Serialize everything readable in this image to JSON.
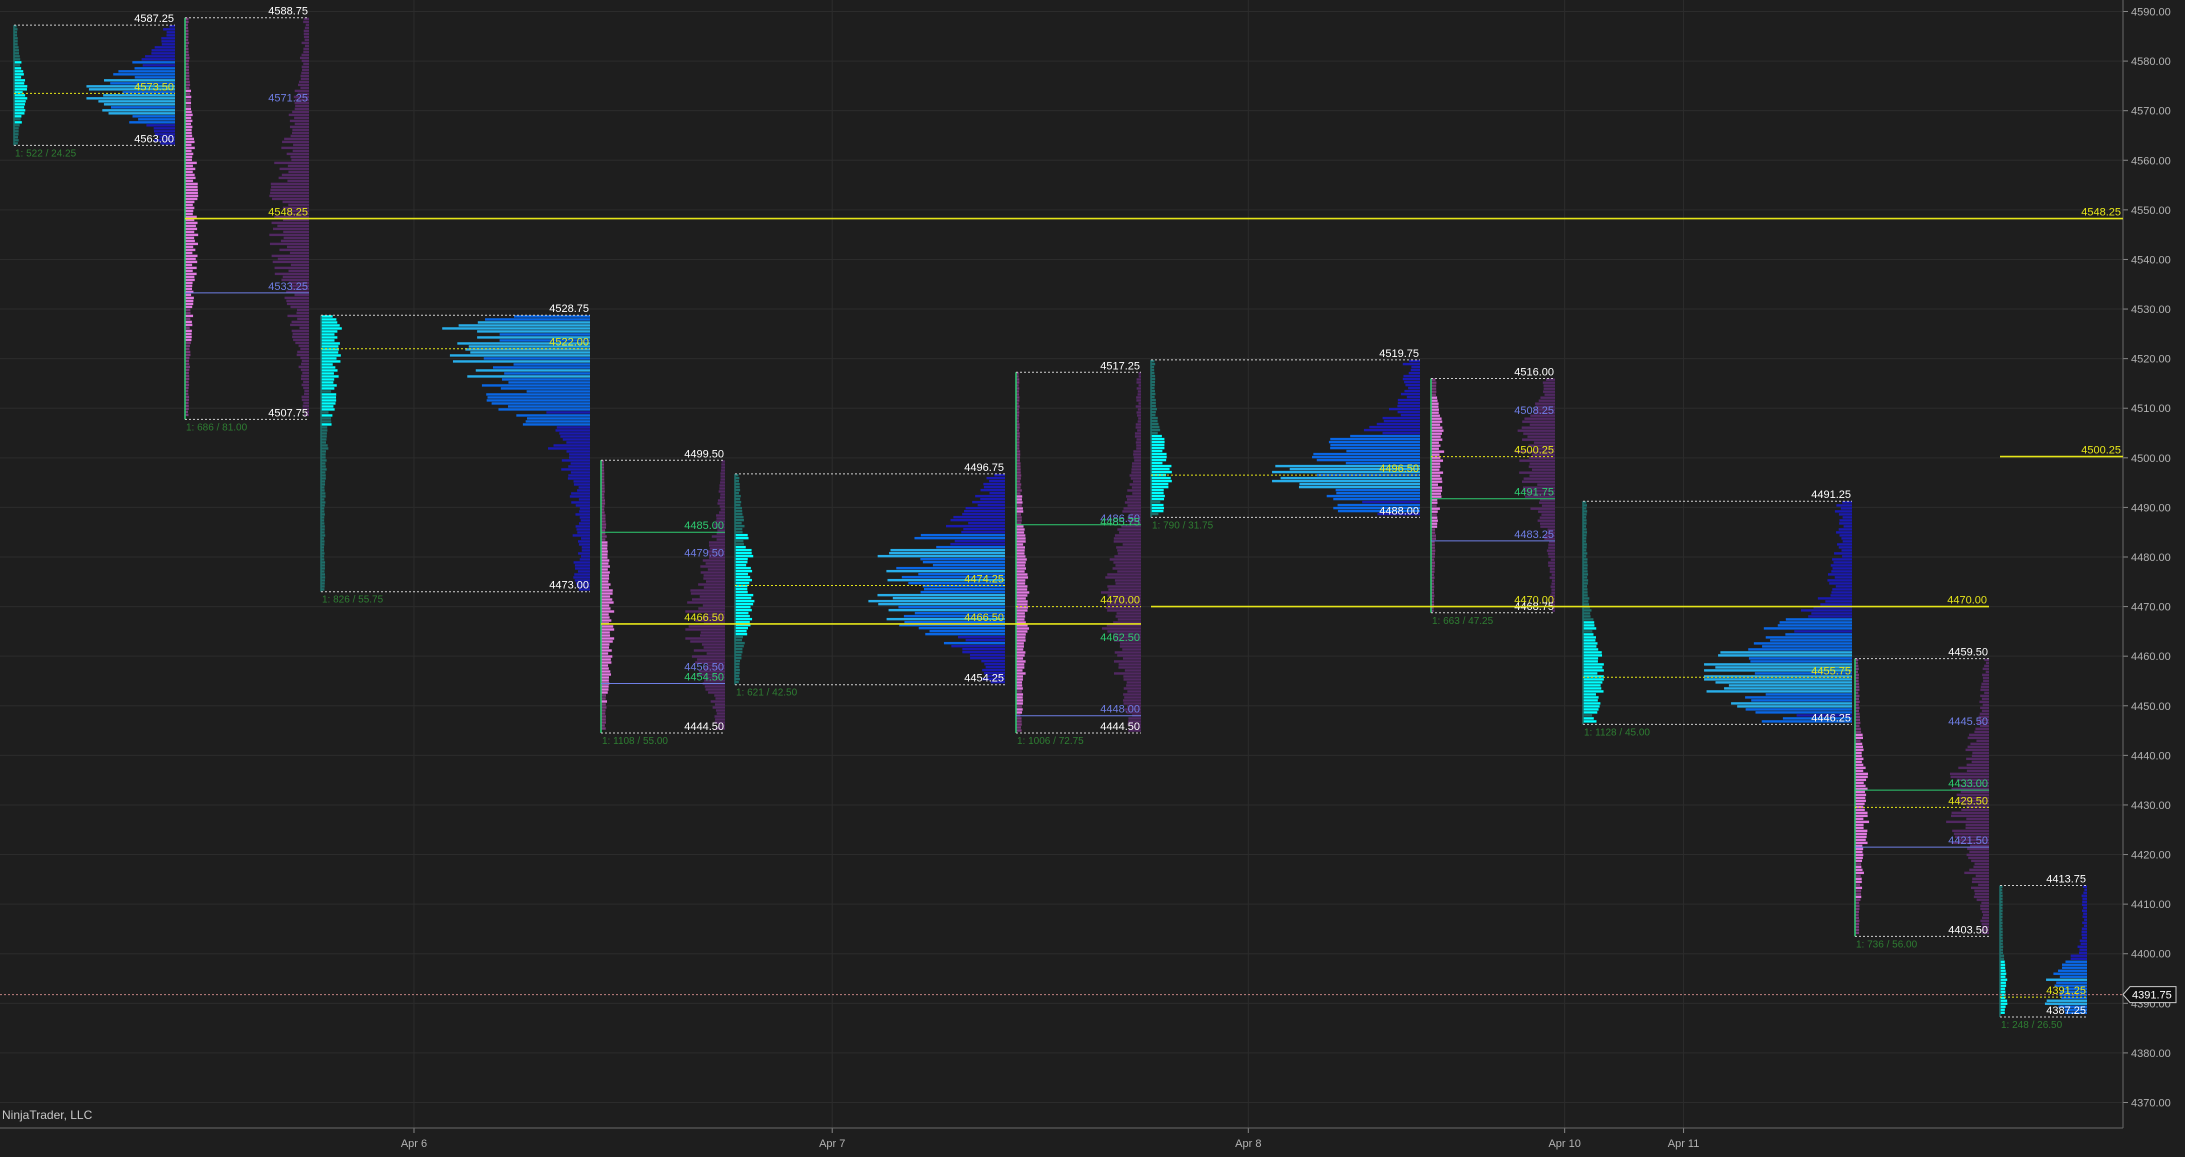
{
  "watermark": "NinjaTrader, LLC",
  "colors": {
    "background": "#1e1e1e",
    "grid": "#2c2c2c",
    "axis_text": "#b4b4b4",
    "box": "#d0d0d0",
    "poc": "#e6e619",
    "vah": "#2ecc71",
    "val": "#6f7fe6",
    "label_white": "#ffffff",
    "stats": "#2e7d32",
    "cyan": "#00ffff",
    "teal": "#1e6e6a",
    "pink": "#e07ae0",
    "purple": "#5a2a6e",
    "blue": "#0a6bf0",
    "navy": "#1a1ab8",
    "current_line": "#c08080"
  },
  "chart_data": {
    "type": "volume_profile",
    "grid": true,
    "ylim": [
      4366,
      4592
    ],
    "y_ticks": [
      "4590.00",
      "4580.00",
      "4570.00",
      "4560.00",
      "4550.00",
      "4540.00",
      "4530.00",
      "4520.00",
      "4510.00",
      "4500.00",
      "4490.00",
      "4480.00",
      "4470.00",
      "4460.00",
      "4450.00",
      "4440.00",
      "4430.00",
      "4420.00",
      "4410.00",
      "4400.00",
      "4390.00",
      "4380.00",
      "4370.00"
    ],
    "x_ticks": [
      {
        "label": "Apr 6",
        "pos": 0.195
      },
      {
        "label": "Apr 7",
        "pos": 0.392
      },
      {
        "label": "Apr 8",
        "pos": 0.588
      },
      {
        "label": "Apr 10",
        "pos": 0.737
      },
      {
        "label": "Apr 11",
        "pos": 0.793
      }
    ],
    "current_price": {
      "value": 4391.75,
      "label": "4391.75"
    },
    "extended_levels": [
      {
        "value": 4548.25,
        "label": "4548.25",
        "from_profile": 1
      },
      {
        "value": 4500.25,
        "label": "4500.25",
        "from_profile": 10
      },
      {
        "value": 4470.0,
        "label": "4470.00",
        "from_profile": 6,
        "to_profile": 9
      },
      {
        "value": 4466.5,
        "label": "",
        "from_profile": 3,
        "to_profile": 5
      }
    ],
    "profiles": [
      {
        "kind": "A",
        "high": 4587.25,
        "low": 4563.0,
        "poc": 4573.5,
        "vah": null,
        "val": null,
        "stats": "1: 522 / 24.25",
        "labels": [
          {
            "v": 4587.25,
            "t": "4587.25",
            "c": "w"
          },
          {
            "v": 4573.5,
            "t": "4573.50",
            "c": "p"
          },
          {
            "v": 4563.0,
            "t": "4563.00",
            "c": "w"
          }
        ]
      },
      {
        "kind": "B",
        "high": 4588.75,
        "low": 4507.75,
        "poc": 4548.25,
        "vah": null,
        "val": 4533.25,
        "stats": "1: 686 / 81.00",
        "labels": [
          {
            "v": 4588.75,
            "t": "4588.75",
            "c": "w"
          },
          {
            "v": 4571.25,
            "t": "4571.25",
            "c": "l"
          },
          {
            "v": 4548.25,
            "t": "4548.25",
            "c": "p"
          },
          {
            "v": 4533.25,
            "t": "4533.25",
            "c": "l"
          },
          {
            "v": 4507.75,
            "t": "4507.75",
            "c": "w"
          }
        ]
      },
      {
        "kind": "A",
        "high": 4528.75,
        "low": 4473.0,
        "poc": 4522.0,
        "vah": null,
        "val": null,
        "stats": "1: 826 / 55.75",
        "labels": [
          {
            "v": 4528.75,
            "t": "4528.75",
            "c": "w"
          },
          {
            "v": 4522.0,
            "t": "4522.00",
            "c": "p"
          },
          {
            "v": 4473.0,
            "t": "4473.00",
            "c": "w"
          }
        ]
      },
      {
        "kind": "B",
        "high": 4499.5,
        "low": 4444.5,
        "poc": 4466.5,
        "vah": 4485.0,
        "val": 4454.5,
        "stats": "1: 1108 / 55.00",
        "labels": [
          {
            "v": 4499.5,
            "t": "4499.50",
            "c": "w"
          },
          {
            "v": 4485.0,
            "t": "4485.00",
            "c": "g"
          },
          {
            "v": 4479.5,
            "t": "4479.50",
            "c": "l"
          },
          {
            "v": 4466.5,
            "t": "4466.50",
            "c": "p"
          },
          {
            "v": 4456.5,
            "t": "4456.50",
            "c": "l"
          },
          {
            "v": 4454.5,
            "t": "4454.50",
            "c": "g"
          },
          {
            "v": 4444.5,
            "t": "4444.50",
            "c": "w"
          }
        ]
      },
      {
        "kind": "A",
        "high": 4496.75,
        "low": 4454.25,
        "poc": 4474.25,
        "vah": null,
        "val": null,
        "stats": "1: 621 / 42.50",
        "labels": [
          {
            "v": 4496.75,
            "t": "4496.75",
            "c": "w"
          },
          {
            "v": 4474.25,
            "t": "4474.25",
            "c": "p"
          },
          {
            "v": 4466.5,
            "t": "4466.50",
            "c": "p"
          },
          {
            "v": 4454.25,
            "t": "4454.25",
            "c": "w"
          }
        ]
      },
      {
        "kind": "B",
        "high": 4517.25,
        "low": 4444.5,
        "poc": 4470.0,
        "vah": 4486.5,
        "val": 4448.0,
        "stats": "1: 1006 / 72.75",
        "labels": [
          {
            "v": 4517.25,
            "t": "4517.25",
            "c": "w"
          },
          {
            "v": 4486.5,
            "t": "4486.50",
            "c": "l"
          },
          {
            "v": 4485.75,
            "t": "4485.75",
            "c": "g"
          },
          {
            "v": 4470.0,
            "t": "4470.00",
            "c": "p"
          },
          {
            "v": 4462.5,
            "t": "4462.50",
            "c": "g"
          },
          {
            "v": 4448.0,
            "t": "4448.00",
            "c": "l"
          },
          {
            "v": 4444.5,
            "t": "4444.50",
            "c": "w"
          }
        ]
      },
      {
        "kind": "A",
        "high": 4519.75,
        "low": 4488.0,
        "poc": 4496.5,
        "vah": null,
        "val": null,
        "stats": "1: 790 / 31.75",
        "labels": [
          {
            "v": 4519.75,
            "t": "4519.75",
            "c": "w"
          },
          {
            "v": 4496.5,
            "t": "4496.50",
            "c": "p"
          },
          {
            "v": 4488.0,
            "t": "4488.00",
            "c": "w"
          }
        ]
      },
      {
        "kind": "B",
        "high": 4516.0,
        "low": 4468.75,
        "poc": 4500.25,
        "vah": 4491.75,
        "val": 4483.25,
        "stats": "1: 663 / 47.25",
        "labels": [
          {
            "v": 4516.0,
            "t": "4516.00",
            "c": "w"
          },
          {
            "v": 4508.25,
            "t": "4508.25",
            "c": "l"
          },
          {
            "v": 4500.25,
            "t": "4500.25",
            "c": "p"
          },
          {
            "v": 4491.75,
            "t": "4491.75",
            "c": "g"
          },
          {
            "v": 4483.25,
            "t": "4483.25",
            "c": "l"
          },
          {
            "v": 4470.0,
            "t": "4470.00",
            "c": "p"
          },
          {
            "v": 4468.75,
            "t": "4468.75",
            "c": "w"
          }
        ]
      },
      {
        "kind": "A",
        "high": 4491.25,
        "low": 4446.25,
        "poc": 4455.75,
        "vah": null,
        "val": null,
        "stats": "1: 1128 / 45.00",
        "labels": [
          {
            "v": 4491.25,
            "t": "4491.25",
            "c": "w"
          },
          {
            "v": 4455.75,
            "t": "4455.75",
            "c": "p"
          },
          {
            "v": 4446.25,
            "t": "4446.25",
            "c": "w"
          }
        ]
      },
      {
        "kind": "B",
        "high": 4459.5,
        "low": 4403.5,
        "poc": 4429.5,
        "vah": 4433.0,
        "val": 4421.5,
        "stats": "1: 736 / 56.00",
        "labels": [
          {
            "v": 4459.5,
            "t": "4459.50",
            "c": "w"
          },
          {
            "v": 4445.5,
            "t": "4445.50",
            "c": "l"
          },
          {
            "v": 4433.0,
            "t": "4433.00",
            "c": "g"
          },
          {
            "v": 4429.5,
            "t": "4429.50",
            "c": "p"
          },
          {
            "v": 4421.5,
            "t": "4421.50",
            "c": "l"
          },
          {
            "v": 4403.5,
            "t": "4403.50",
            "c": "w"
          }
        ]
      },
      {
        "kind": "A",
        "high": 4413.75,
        "low": 4387.25,
        "poc": 4391.25,
        "vah": null,
        "val": null,
        "stats": "1: 248 / 26.50",
        "labels": [
          {
            "v": 4413.75,
            "t": "4413.75",
            "c": "w"
          },
          {
            "v": 4391.25,
            "t": "4391.25",
            "c": "p"
          },
          {
            "v": 4387.25,
            "t": "4387.25",
            "c": "w"
          }
        ]
      }
    ]
  }
}
